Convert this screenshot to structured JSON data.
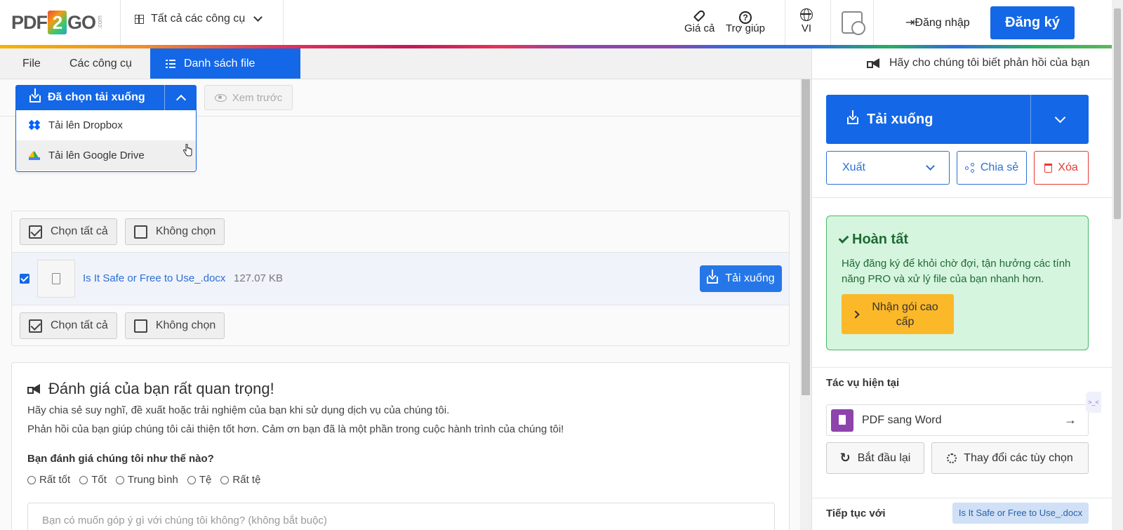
{
  "header": {
    "logo_text_1": "PDF",
    "logo_text_2": "2",
    "logo_text_3": "GO",
    "logo_suffix": ".com",
    "tools_label": "Tất cả các công cụ",
    "pricing_label": "Giá cả",
    "help_label": "Trợ giúp",
    "language_label": "VI",
    "login_label": "Đăng nhập",
    "signup_label": "Đăng ký"
  },
  "tabs": {
    "file": "File",
    "tools": "Các công cụ",
    "file_list": "Danh sách file"
  },
  "toolbar": {
    "download_selected": "Đã chọn tải xuống",
    "preview": "Xem trước",
    "dropdown": [
      "Tải lên Dropbox",
      "Tải lên Google Drive"
    ]
  },
  "file_list": {
    "select_all": "Chọn tất cả",
    "select_none": "Không chọn",
    "file_name": "Is It Safe or Free to Use_.docx",
    "file_size": "127.07 KB",
    "download": "Tải xuống"
  },
  "feedback": {
    "title": "Đánh giá của bạn rất quan trọng!",
    "line1": "Hãy chia sẻ suy nghĩ, đề xuất hoặc trải nghiệm của bạn khi sử dụng dịch vụ của chúng tôi.",
    "line2": "Phản hồi của bạn giúp chúng tôi cải thiện tốt hơn. Cảm ơn bạn đã là một phần trong cuộc hành trình của chúng tôi!",
    "question": "Bạn đánh giá chúng tôi như thế nào?",
    "ratings": [
      "Rất tốt",
      "Tốt",
      "Trung bình",
      "Tệ",
      "Rất tệ"
    ],
    "input_placeholder": "Bạn có muốn góp ý gì với chúng tôi không? (không bắt buộc)"
  },
  "right": {
    "feedback_link": "Hãy cho chúng tôi biết phản hồi của bạn",
    "download": "Tải xuống",
    "export": "Xuất",
    "share": "Chia sẻ",
    "delete": "Xóa",
    "done_title": "Hoàn tất",
    "done_text": "Hãy đăng ký để khỏi chờ đợi, tận hưởng các tính năng PRO và xử lý file của bạn nhanh hơn.",
    "premium": "Nhận gói cao cấp",
    "current_task": "Tác vụ hiện tại",
    "task_name": "PDF sang Word",
    "restart": "Bắt đầu lại",
    "change_options": "Thay đổi các tùy chọn",
    "continue_with": "Tiếp tục với",
    "continue_file": "Is It Safe or Free to Use_.docx"
  }
}
